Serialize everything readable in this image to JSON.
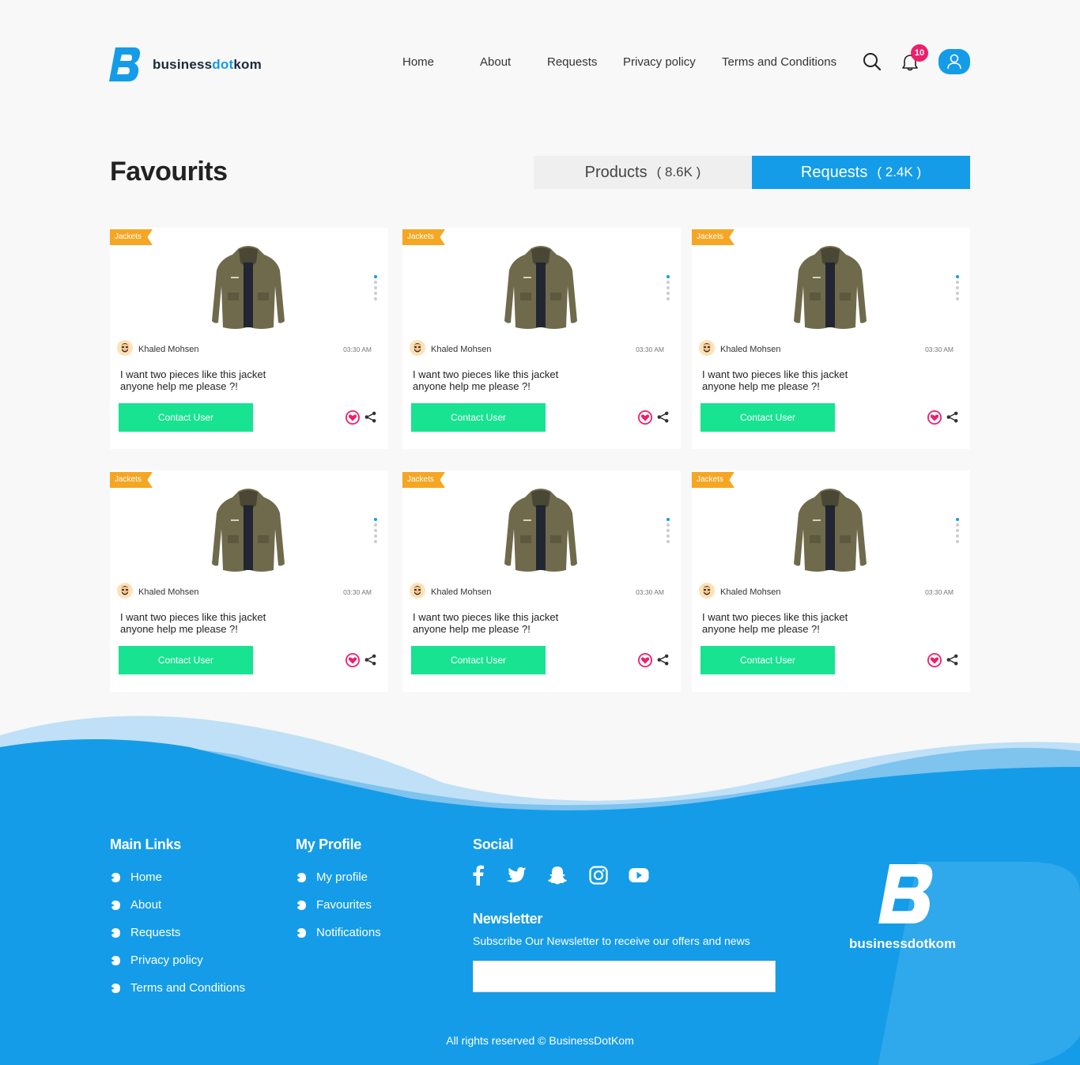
{
  "brand": {
    "name_part1": "business",
    "name_part2": "dot",
    "name_part3": "kom",
    "primary_color": "#149ce8",
    "accent_color": "#17e391",
    "badge_color": "#ec1f6b",
    "tag_color": "#f5a623"
  },
  "nav": {
    "items": [
      {
        "label": "Home"
      },
      {
        "label": "About"
      },
      {
        "label": "Requests"
      },
      {
        "label": "Privacy policy"
      },
      {
        "label": "Terms and Conditions"
      }
    ],
    "notification_count": "10",
    "icons": [
      "search-icon",
      "bell-icon",
      "user-icon"
    ]
  },
  "page": {
    "title": "Favourits",
    "tabs": [
      {
        "label": "Products",
        "count": "( 8.6K )",
        "active": false
      },
      {
        "label": "Requests",
        "count": "( 2.4K )",
        "active": true
      }
    ]
  },
  "cards": [
    {
      "tag": "Jackets",
      "user": "Khaled Mohsen",
      "time": "03:30 AM",
      "text": "I want two pieces like this jacket anyone help me please ?!",
      "button": "Contact User"
    },
    {
      "tag": "Jackets",
      "user": "Khaled Mohsen",
      "time": "03:30 AM",
      "text": "I want two pieces like this jacket anyone help me please ?!",
      "button": "Contact User"
    },
    {
      "tag": "Jackets",
      "user": "Khaled Mohsen",
      "time": "03:30 AM",
      "text": "I want two pieces like this jacket anyone help me please ?!",
      "button": "Contact User"
    },
    {
      "tag": "Jackets",
      "user": "Khaled Mohsen",
      "time": "03:30 AM",
      "text": "I want two pieces like this jacket anyone help me please ?!",
      "button": "Contact User"
    },
    {
      "tag": "Jackets",
      "user": "Khaled Mohsen",
      "time": "03:30 AM",
      "text": "I want two pieces like this jacket anyone help me please ?!",
      "button": "Contact User"
    },
    {
      "tag": "Jackets",
      "user": "Khaled Mohsen",
      "time": "03:30 AM",
      "text": "I want two pieces like this jacket anyone help me please ?!",
      "button": "Contact User"
    }
  ],
  "footer": {
    "main_links_title": "Main Links",
    "main_links": [
      "Home",
      "About",
      "Requests",
      "Privacy policy",
      "Terms and Conditions"
    ],
    "profile_title": "My Profile",
    "profile_links": [
      "My profile",
      "Favourites",
      "Notifications"
    ],
    "social_title": "Social",
    "social_icons": [
      "facebook-icon",
      "twitter-icon",
      "snapchat-icon",
      "instagram-icon",
      "youtube-icon"
    ],
    "newsletter_title": "Newsletter",
    "newsletter_text": "Subscribe Our Newsletter to receive our offers and news",
    "newsletter_placeholder": "",
    "copyright": "All rights reserved © BusinessDotKom"
  }
}
